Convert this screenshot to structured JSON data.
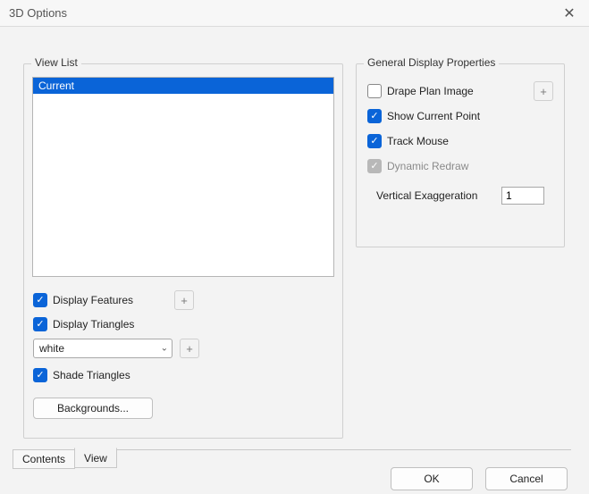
{
  "window": {
    "title": "3D Options",
    "close_glyph": "✕"
  },
  "view_list": {
    "legend": "View List",
    "items": [
      "Current"
    ],
    "selected_index": 0,
    "display_features": {
      "label": "Display Features",
      "checked": true
    },
    "display_triangles": {
      "label": "Display Triangles",
      "checked": true
    },
    "color_select": {
      "value": "white",
      "caret_glyph": "⌄"
    },
    "color_plus_glyph": "+",
    "features_plus_glyph": "+",
    "shade_triangles": {
      "label": "Shade Triangles",
      "checked": true
    },
    "backgrounds_button": "Backgrounds..."
  },
  "general": {
    "legend": "General Display Properties",
    "drape_plan": {
      "label": "Drape Plan Image",
      "checked": false
    },
    "drape_plus_glyph": "+",
    "show_current_point": {
      "label": "Show Current Point",
      "checked": true
    },
    "track_mouse": {
      "label": "Track Mouse",
      "checked": true
    },
    "dynamic_redraw": {
      "label": "Dynamic Redraw",
      "checked": true,
      "disabled": true
    },
    "vertical_exag": {
      "label": "Vertical Exaggeration",
      "value": "1"
    }
  },
  "tabs": {
    "items": [
      {
        "label": "Contents",
        "active": false
      },
      {
        "label": "View",
        "active": true
      }
    ]
  },
  "buttons": {
    "ok": "OK",
    "cancel": "Cancel"
  }
}
